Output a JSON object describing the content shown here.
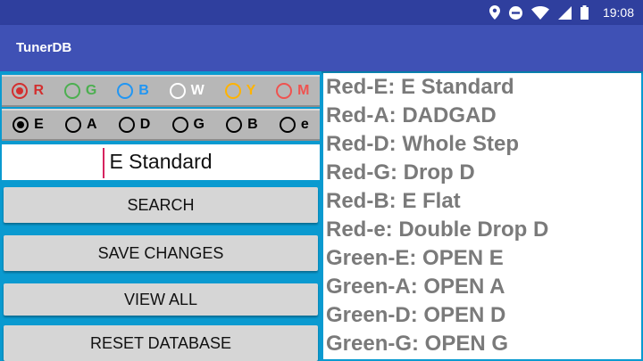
{
  "status_bar": {
    "time": "19:08",
    "icons": [
      "location-icon",
      "do-not-disturb-icon",
      "wifi-icon",
      "signal-icon",
      "battery-icon"
    ]
  },
  "app_bar": {
    "title": "TunerDB"
  },
  "color_options": [
    {
      "label": "R",
      "color": "#d32f2f",
      "checked": true
    },
    {
      "label": "G",
      "color": "#4caf50",
      "checked": false
    },
    {
      "label": "B",
      "color": "#2196f3",
      "checked": false
    },
    {
      "label": "W",
      "color": "#ffffff",
      "checked": false
    },
    {
      "label": "Y",
      "color": "#ffb300",
      "checked": false
    },
    {
      "label": "M",
      "color": "#ef5350",
      "checked": false
    }
  ],
  "string_options": [
    {
      "label": "E",
      "checked": true
    },
    {
      "label": "A",
      "checked": false
    },
    {
      "label": "D",
      "checked": false
    },
    {
      "label": "G",
      "checked": false
    },
    {
      "label": "B",
      "checked": false
    },
    {
      "label": "e",
      "checked": false
    }
  ],
  "input": {
    "value": "E Standard"
  },
  "buttons": {
    "search": "SEARCH",
    "save": "SAVE CHANGES",
    "view_all": "VIEW ALL",
    "reset": "RESET DATABASE"
  },
  "results": [
    "Red-E: E Standard",
    "Red-A: DADGAD",
    "Red-D: Whole Step",
    "Red-G: Drop D",
    "Red-B: E Flat",
    "Red-e: Double Drop D",
    "Green-E: OPEN E",
    "Green-A: OPEN A",
    "Green-D: OPEN D",
    "Green-G: OPEN G"
  ],
  "colors": {
    "status_bar": "#2f3f9e",
    "app_bar": "#3f51b5",
    "background": "#0a9ad0",
    "list_text": "#7a7a7a",
    "cursor": "#d6235f"
  }
}
